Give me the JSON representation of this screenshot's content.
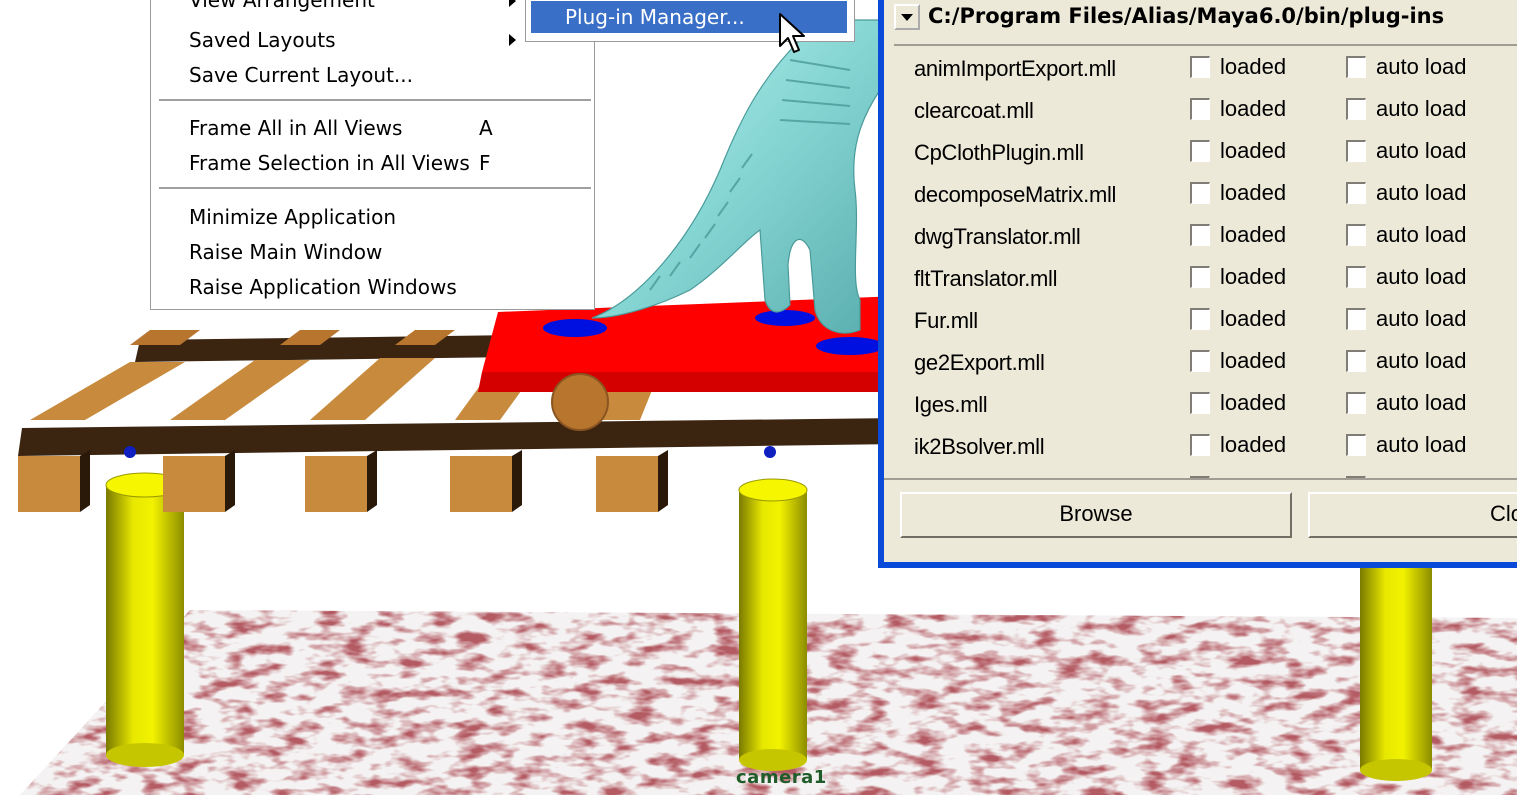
{
  "viewport": {
    "camera_label": "camera1"
  },
  "window_menu": {
    "items": [
      {
        "label": "View Arrangement",
        "has_submenu": true
      },
      {
        "label": "Saved Layouts",
        "has_submenu": true
      },
      {
        "label": "Save Current Layout..."
      },
      {
        "label": "Frame All in All Views",
        "accel": "A"
      },
      {
        "label": "Frame Selection in All Views",
        "accel": "F"
      },
      {
        "label": "Minimize Application"
      },
      {
        "label": "Raise Main Window"
      },
      {
        "label": "Raise Application Windows"
      }
    ],
    "submenu": {
      "highlighted": "Plug-in Manager..."
    }
  },
  "plugin_manager": {
    "path": "C:/Program Files/Alias/Maya6.0/bin/plug-ins",
    "loaded_label": "loaded",
    "autoload_label": "auto load",
    "plugins": [
      {
        "name": "animImportExport.mll",
        "loaded": false,
        "auto_load": false
      },
      {
        "name": "clearcoat.mll",
        "loaded": false,
        "auto_load": false
      },
      {
        "name": "CpClothPlugin.mll",
        "loaded": false,
        "auto_load": false
      },
      {
        "name": "decomposeMatrix.mll",
        "loaded": false,
        "auto_load": false
      },
      {
        "name": "dwgTranslator.mll",
        "loaded": false,
        "auto_load": false
      },
      {
        "name": "fltTranslator.mll",
        "loaded": false,
        "auto_load": false
      },
      {
        "name": "Fur.mll",
        "loaded": false,
        "auto_load": false
      },
      {
        "name": "ge2Export.mll",
        "loaded": false,
        "auto_load": false
      },
      {
        "name": "Iges.mll",
        "loaded": false,
        "auto_load": false
      },
      {
        "name": "ik2Bsolver.mll",
        "loaded": false,
        "auto_load": false
      }
    ],
    "browse_label": "Browse",
    "close_label": "Close"
  },
  "colors": {
    "menu_highlight": "#3a6fc7",
    "window_frame": "#0a4ad8",
    "dialog_bg": "#ece9d8",
    "camera_label": "#1f5c2a"
  }
}
